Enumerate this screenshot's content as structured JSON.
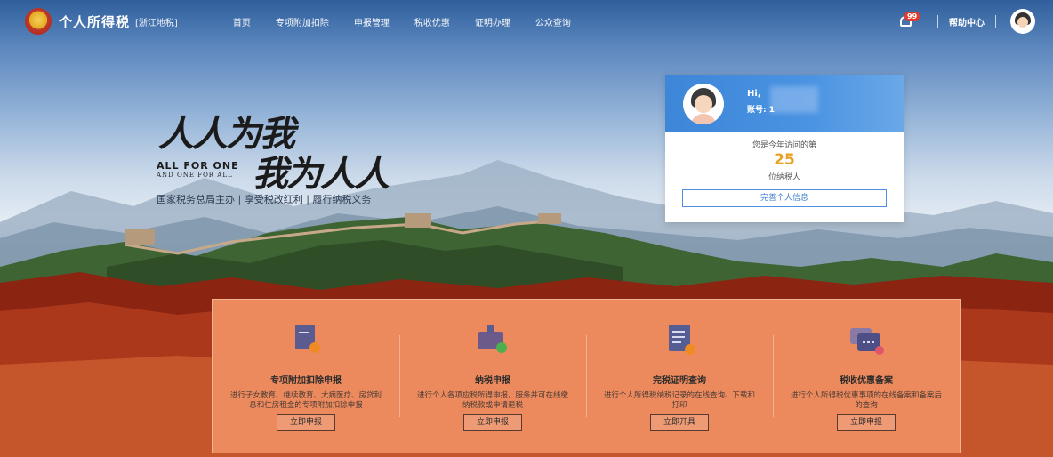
{
  "header": {
    "app_title": "个人所得税",
    "region": "[浙江地税]",
    "nav": [
      "首页",
      "专项附加扣除",
      "申报管理",
      "税收优惠",
      "证明办理",
      "公众查询"
    ],
    "notification_count": "99",
    "help_label": "帮助中心"
  },
  "hero": {
    "calligraphy_line1": "人人为我",
    "calligraphy_line2": "我为人人",
    "english_line1": "ALL FOR ONE",
    "english_line2": "AND ONE FOR ALL",
    "tagline": "国家税务总局主办 | 享受税改红利 | 履行纳税义务"
  },
  "user_card": {
    "greeting": "Hi,",
    "account_label": "账号: 1",
    "visit_prefix": "您是今年访问的第",
    "visit_count": "25",
    "visit_suffix": "位纳税人",
    "complete_button": "完善个人信息"
  },
  "services": [
    {
      "title": "专项附加扣除申报",
      "description": "进行子女教育、继续教育、大病医疗、房贷利息和住房租金的专项附加扣除申报",
      "button": "立即申报",
      "icon": "deduction-form-icon"
    },
    {
      "title": "纳税申报",
      "description": "进行个人各项应税所得申报，服务并可在线缴纳税款或申请退税",
      "button": "立即申报",
      "icon": "tax-filing-icon"
    },
    {
      "title": "完税证明查询",
      "description": "进行个人所得税纳税记录的在线查询、下载和打印",
      "button": "立即开具",
      "icon": "tax-certificate-icon"
    },
    {
      "title": "税收优惠备案",
      "description": "进行个人所得税优惠事项的在线备案和备案后的查询",
      "button": "立即申报",
      "icon": "tax-benefit-icon"
    }
  ],
  "colors": {
    "accent_blue": "#4a93e2",
    "panel_orange": "#ec8a5d",
    "visit_number": "#e8a123"
  }
}
